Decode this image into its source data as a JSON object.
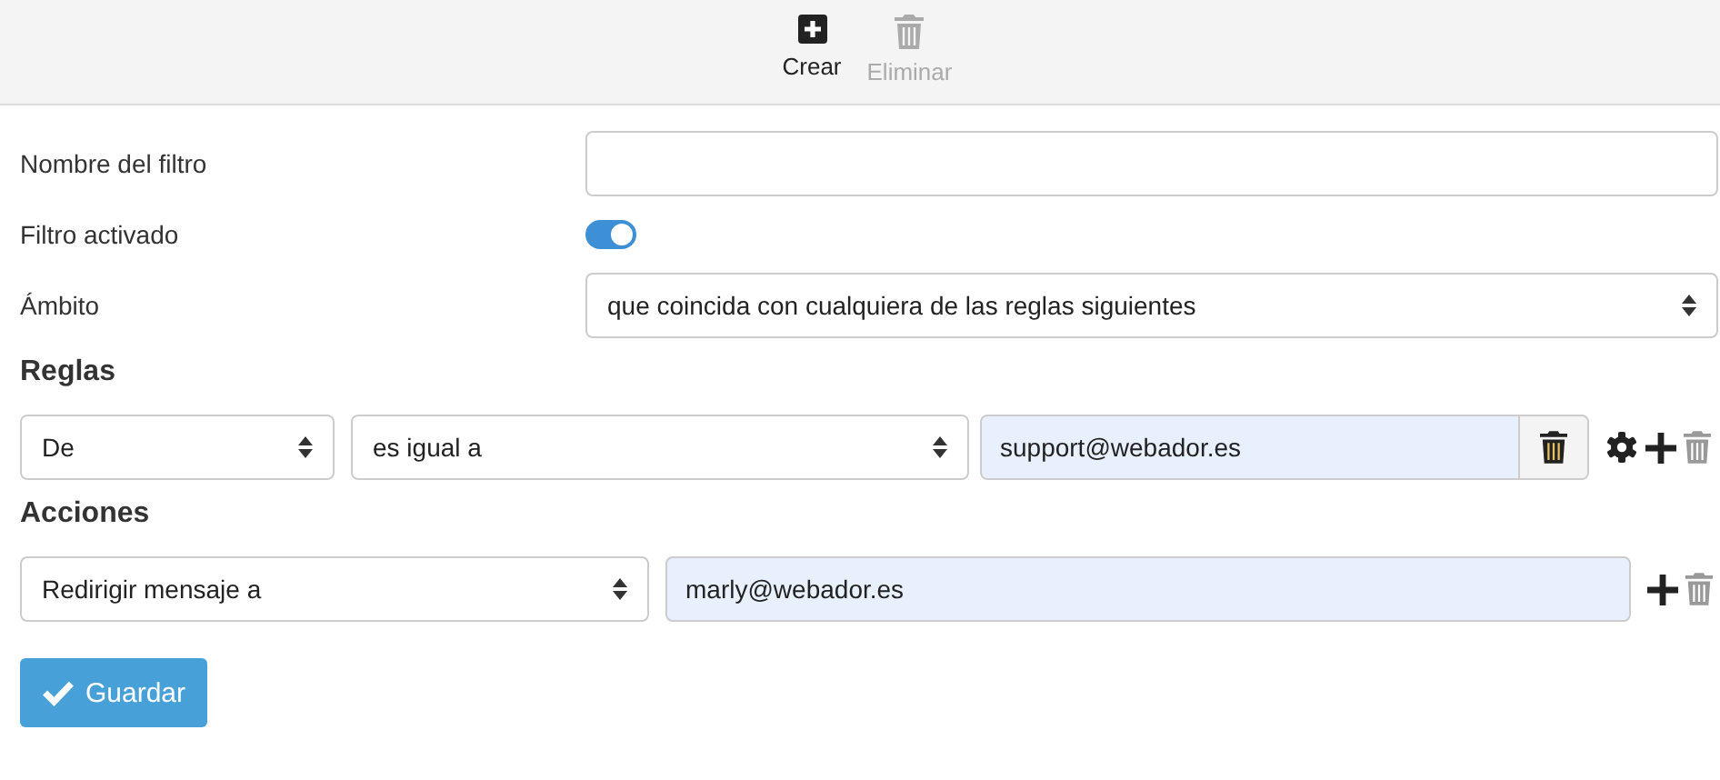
{
  "toolbar": {
    "buttons": [
      {
        "label": "Crear",
        "kind": "create",
        "disabled": false
      },
      {
        "label": "Eliminar",
        "kind": "delete",
        "disabled": true
      }
    ]
  },
  "fields": [
    {
      "kind": "text",
      "label": "Nombre del filtro"
    },
    {
      "kind": "toggle",
      "label": "Filtro activado",
      "on": true
    },
    {
      "kind": "select",
      "label": "Ámbito",
      "value": "que coincida con cualquiera de las reglas siguientes"
    }
  ],
  "rules": {
    "heading": "Reglas",
    "items": [
      {
        "header": "De",
        "operator": "es igual a",
        "value": "support@webador.es",
        "remove_disabled": true
      }
    ]
  },
  "actions": {
    "heading": "Acciones",
    "items": [
      {
        "action": "Redirigir mensaje a",
        "value": "marly@webador.es",
        "remove_disabled": true
      }
    ]
  },
  "save_button": {
    "label": "Guardar"
  }
}
